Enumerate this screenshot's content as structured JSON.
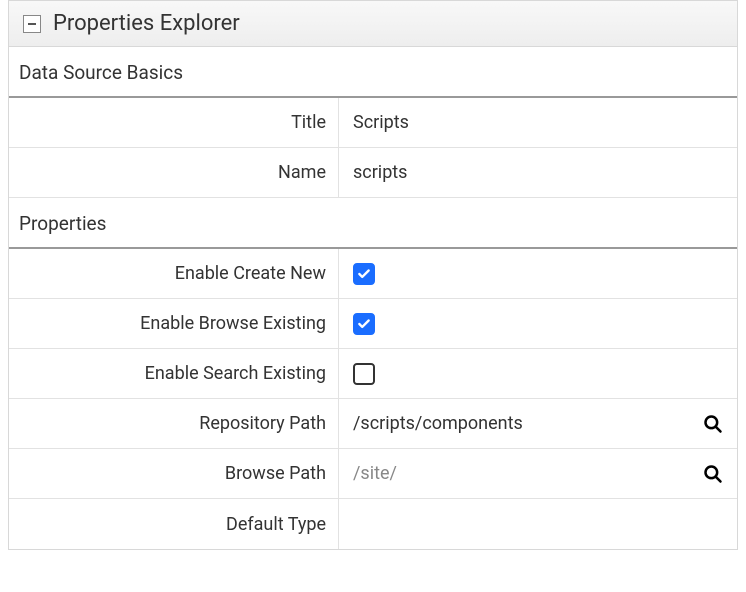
{
  "panel": {
    "title": "Properties Explorer"
  },
  "sections": {
    "basics": {
      "header": "Data Source Basics",
      "titleLabel": "Title",
      "titleValue": "Scripts",
      "nameLabel": "Name",
      "nameValue": "scripts"
    },
    "properties": {
      "header": "Properties",
      "enableCreateNewLabel": "Enable Create New",
      "enableCreateNewChecked": true,
      "enableBrowseExistingLabel": "Enable Browse Existing",
      "enableBrowseExistingChecked": true,
      "enableSearchExistingLabel": "Enable Search Existing",
      "enableSearchExistingChecked": false,
      "repositoryPathLabel": "Repository Path",
      "repositoryPathValue": "/scripts/components",
      "browsePathLabel": "Browse Path",
      "browsePathPlaceholder": "/site/",
      "browsePathValue": "",
      "defaultTypeLabel": "Default Type",
      "defaultTypeValue": ""
    }
  }
}
